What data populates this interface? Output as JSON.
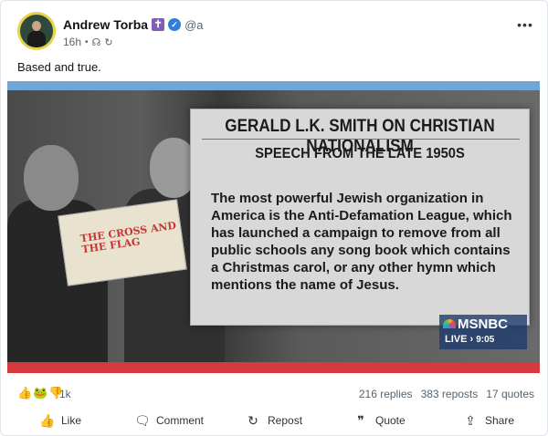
{
  "post": {
    "author_name": "Andrew Torba",
    "handle": "@a",
    "time": "16h",
    "text": "Based and true.",
    "badge_icons": [
      "cross-icon",
      "verified-icon"
    ],
    "meta_icons": [
      "people-icon",
      "edit-icon"
    ]
  },
  "media": {
    "panel_title": "GERALD L.K. SMITH ON CHRISTIAN NATIONALISM",
    "panel_subtitle": "SPEECH FROM THE LATE 1950S",
    "panel_body": "The most powerful Jewish organization in America is the Anti-Defamation League, which has launched a campaign to remove from all public schools any song book which contains a Christmas carol, or any other hymn which mentions the name of Jesus.",
    "book_title": "THE CROSS AND THE FLAG",
    "network": "MSNBC",
    "live_label": "LIVE",
    "live_time": "9:05"
  },
  "stats": {
    "reactions_count": "1k",
    "replies": "216 replies",
    "reposts": "383 reposts",
    "quotes": "17 quotes"
  },
  "actions": {
    "like": "Like",
    "comment": "Comment",
    "repost": "Repost",
    "quote": "Quote",
    "share": "Share"
  },
  "colors": {
    "verified": "#2f7fd8",
    "cross_badge": "#7f5fb5",
    "avatar_ring": "#e8d24a"
  }
}
